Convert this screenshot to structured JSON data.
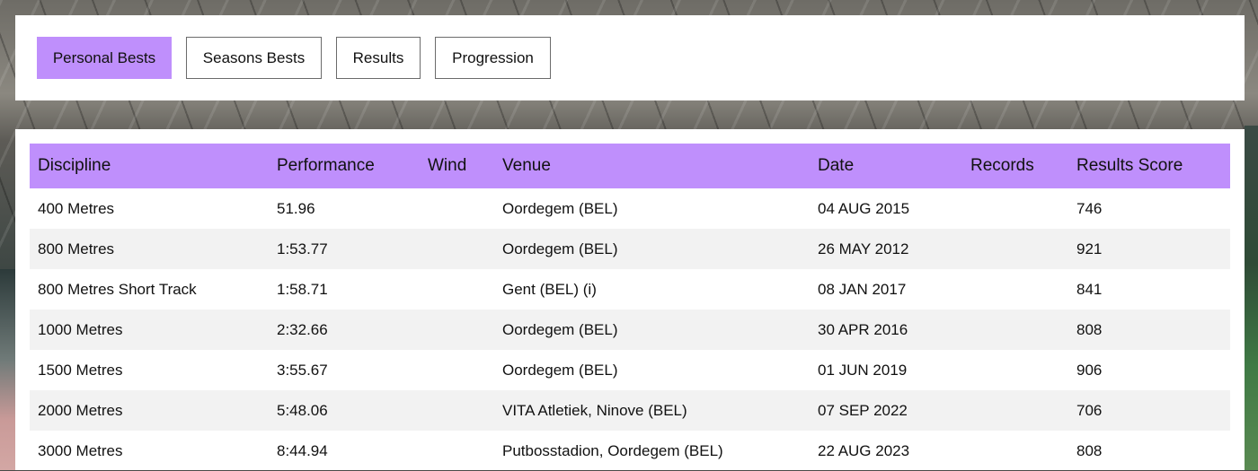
{
  "tabs": [
    {
      "label": "Personal Bests",
      "active": true
    },
    {
      "label": "Seasons Bests",
      "active": false
    },
    {
      "label": "Results",
      "active": false
    },
    {
      "label": "Progression",
      "active": false
    }
  ],
  "table": {
    "headers": {
      "discipline": "Discipline",
      "performance": "Performance",
      "wind": "Wind",
      "venue": "Venue",
      "date": "Date",
      "records": "Records",
      "score": "Results Score"
    },
    "rows": [
      {
        "discipline": "400 Metres",
        "performance": "51.96",
        "wind": "",
        "venue": "Oordegem (BEL)",
        "date": "04 AUG 2015",
        "records": "",
        "score": "746"
      },
      {
        "discipline": "800 Metres",
        "performance": "1:53.77",
        "wind": "",
        "venue": "Oordegem (BEL)",
        "date": "26 MAY 2012",
        "records": "",
        "score": "921"
      },
      {
        "discipline": "800 Metres Short Track",
        "performance": "1:58.71",
        "wind": "",
        "venue": "Gent (BEL) (i)",
        "date": "08 JAN 2017",
        "records": "",
        "score": "841"
      },
      {
        "discipline": "1000 Metres",
        "performance": "2:32.66",
        "wind": "",
        "venue": "Oordegem (BEL)",
        "date": "30 APR 2016",
        "records": "",
        "score": "808"
      },
      {
        "discipline": "1500 Metres",
        "performance": "3:55.67",
        "wind": "",
        "venue": "Oordegem (BEL)",
        "date": "01 JUN 2019",
        "records": "",
        "score": "906"
      },
      {
        "discipline": "2000 Metres",
        "performance": "5:48.06",
        "wind": "",
        "venue": "VITA Atletiek, Ninove (BEL)",
        "date": "07 SEP 2022",
        "records": "",
        "score": "706"
      },
      {
        "discipline": "3000 Metres",
        "performance": "8:44.94",
        "wind": "",
        "venue": "Putbosstadion, Oordegem (BEL)",
        "date": "22 AUG 2023",
        "records": "",
        "score": "808"
      }
    ]
  },
  "colors": {
    "accent": "#bf8ffc",
    "row_alt": "#f2f2f2"
  }
}
